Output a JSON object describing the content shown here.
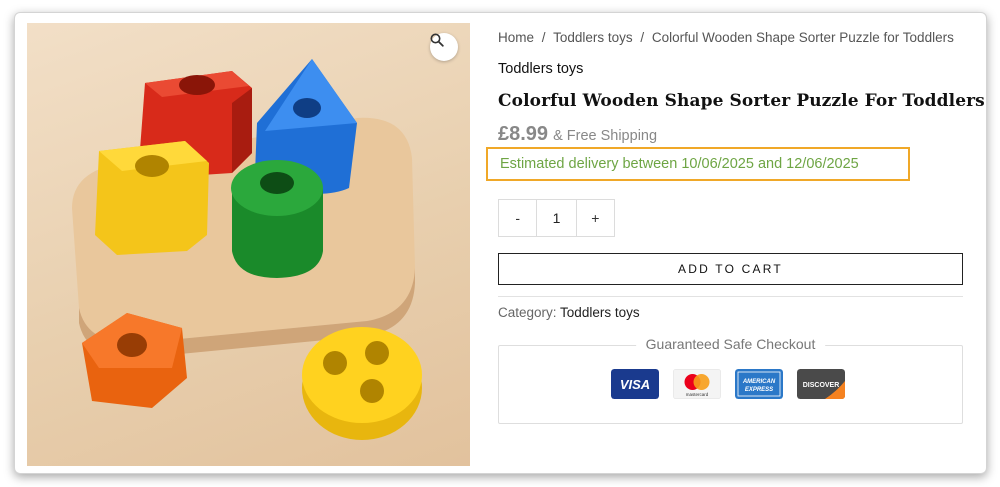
{
  "breadcrumb": {
    "home": "Home",
    "category": "Toddlers toys",
    "current": "Colorful Wooden Shape Sorter Puzzle for Toddlers",
    "separator": "/"
  },
  "product": {
    "category_heading": "Toddlers toys",
    "title": "Colorful Wooden Shape Sorter Puzzle For Toddlers",
    "price": "£8.99",
    "shipping": "& Free Shipping",
    "delivery": "Estimated delivery between 10/06/2025 and 12/06/2025",
    "delivery_highlight_color": "#f0a828",
    "delivery_text_color": "#6ea544"
  },
  "quantity": {
    "minus": "-",
    "value": "1",
    "plus": "+"
  },
  "cart": {
    "add_label": "ADD TO CART"
  },
  "meta": {
    "category_label": "Category:",
    "category_value": "Toddlers toys"
  },
  "checkout": {
    "title": "Guaranteed Safe Checkout",
    "cards": [
      {
        "name": "visa-card-icon",
        "label": "VISA"
      },
      {
        "name": "mastercard-card-icon",
        "label": "mastercard"
      },
      {
        "name": "amex-card-icon",
        "label": "AMERICAN EXPRESS"
      },
      {
        "name": "discover-card-icon",
        "label": "DISCOVER"
      }
    ]
  },
  "gallery": {
    "zoom_icon": "magnifier-icon"
  }
}
